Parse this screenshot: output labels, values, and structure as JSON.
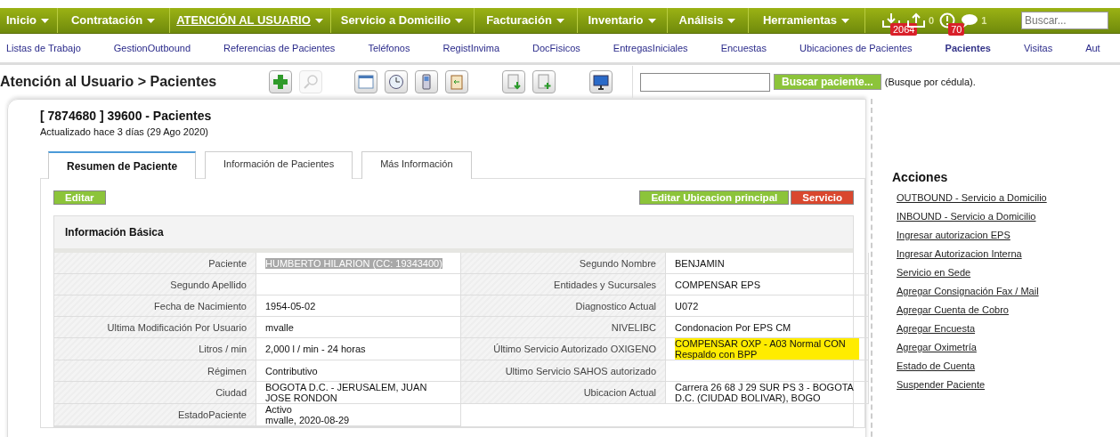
{
  "menu": [
    {
      "label": "Inicio",
      "selected": false
    },
    {
      "label": "Contratación",
      "selected": false
    },
    {
      "label": "ATENCIÓN AL USUARIO",
      "selected": true
    },
    {
      "label": "Servicio a Domicilio",
      "selected": false
    },
    {
      "label": "Facturación",
      "selected": false
    },
    {
      "label": "Inventario",
      "selected": false
    },
    {
      "label": "Análisis",
      "selected": false
    },
    {
      "label": "Herramientas",
      "selected": false
    }
  ],
  "notifications": [
    {
      "kind": "download",
      "badge": "2064"
    },
    {
      "kind": "upload",
      "count": "0"
    },
    {
      "kind": "alert",
      "badge": "70"
    },
    {
      "kind": "chat",
      "count": "1"
    }
  ],
  "search": {
    "placeholder": "Buscar..."
  },
  "submenu": [
    {
      "label": "Listas de Trabajo",
      "selected": false
    },
    {
      "label": "GestionOutbound",
      "selected": false
    },
    {
      "label": "Referencias de Pacientes",
      "selected": false
    },
    {
      "label": "Teléfonos",
      "selected": false
    },
    {
      "label": "RegistInvima",
      "selected": false
    },
    {
      "label": "DocFisicos",
      "selected": false
    },
    {
      "label": "EntregasIniciales",
      "selected": false
    },
    {
      "label": "Encuestas",
      "selected": false
    },
    {
      "label": "Ubicaciones de Pacientes",
      "selected": false
    },
    {
      "label": "Pacientes",
      "selected": true
    },
    {
      "label": "Visitas",
      "selected": false
    },
    {
      "label": "Aut",
      "selected": false
    }
  ],
  "breadcrumb": {
    "parent": "Atención al Usuario",
    "separator": ">",
    "current": "Pacientes"
  },
  "toolbar": [
    {
      "kind": "plus",
      "disabled": false
    },
    {
      "kind": "search",
      "disabled": true
    },
    {
      "kind": "calendar",
      "disabled": false
    },
    {
      "kind": "clock",
      "disabled": false
    },
    {
      "kind": "phone",
      "disabled": false
    },
    {
      "kind": "clipboard",
      "disabled": false
    },
    {
      "kind": "doc-down",
      "disabled": false
    },
    {
      "kind": "doc-plus",
      "disabled": false
    },
    {
      "kind": "monitor",
      "disabled": false
    }
  ],
  "patient_search": {
    "button": "Buscar paciente...",
    "hint": "(Busque por cédula)."
  },
  "record": {
    "title": "[ 7874680 ] 39600 - Pacientes",
    "updated": "Actualizado hace 3 días (29 Ago 2020)"
  },
  "tabs": [
    {
      "label": "Resumen de Paciente",
      "selected": true
    },
    {
      "label": "Información de Pacientes",
      "selected": false
    },
    {
      "label": "Más Información",
      "selected": false
    }
  ],
  "buttons": [
    {
      "label": "Editar",
      "kind": "green"
    },
    {
      "label": "Editar Ubicacion principal",
      "kind": "green"
    },
    {
      "label": "Servicio",
      "kind": "red"
    }
  ],
  "section": {
    "title": "Información Básica"
  },
  "rows": [
    [
      {
        "label": "Paciente",
        "value": "HUMBERTO HILARION (CC: 19343400)",
        "selected": true,
        "highlighted": false
      },
      {
        "label": "Segundo Nombre",
        "value": "BENJAMIN",
        "selected": false,
        "highlighted": false
      }
    ],
    [
      {
        "label": "Segundo Apellido",
        "selected": false,
        "highlighted": false
      },
      {
        "label": "Entidades y Sucursales",
        "value": "COMPENSAR EPS",
        "selected": false,
        "highlighted": false
      }
    ],
    [
      {
        "label": "Fecha de Nacimiento",
        "value": "1954-05-02",
        "selected": false,
        "highlighted": false
      },
      {
        "label": "Diagnostico Actual",
        "value": "U072",
        "selected": false,
        "highlighted": false
      }
    ],
    [
      {
        "label": "Ultima Modificación Por Usuario",
        "value": "mvalle",
        "selected": false,
        "highlighted": false
      },
      {
        "label": "NIVELIBC",
        "value": "Condonacion Por EPS CM",
        "selected": false,
        "highlighted": false
      }
    ],
    [
      {
        "label": "Litros / min",
        "value": "2,000 l / min - 24 horas",
        "selected": false,
        "highlighted": false
      },
      {
        "label": "Último Servicio Autorizado OXIGENO",
        "value": "COMPENSAR OXP - A03 Normal CON Respaldo con BPP",
        "selected": false,
        "highlighted": true
      }
    ],
    [
      {
        "label": "Régimen",
        "value": "Contributivo",
        "selected": false,
        "highlighted": false
      },
      {
        "label": "Ultimo Servicio SAHOS autorizado",
        "selected": false,
        "highlighted": false
      }
    ],
    [
      {
        "label": "Ciudad",
        "value": "BOGOTA D.C. - JERUSALEM, JUAN JOSE RONDON",
        "selected": false,
        "highlighted": false
      },
      {
        "label": "Ubicacion Actual",
        "value": "Carrera 26 68 J 29 SUR PS 3 - BOGOTA D.C. (CIUDAD BOLIVAR), BOGO",
        "selected": false,
        "highlighted": false
      }
    ],
    [
      {
        "label": "EstadoPaciente",
        "value": "Activo\nmvalle, 2020-08-29",
        "selected": false,
        "highlighted": false
      }
    ]
  ],
  "actions": {
    "title": "Acciones",
    "links": [
      "OUTBOUND - Servicio a Domicilio",
      "INBOUND - Servicio a Domicilio",
      "Ingresar autorizacion EPS",
      "Ingresar Autorizacion Interna",
      "Servicio en Sede",
      "Agregar Consignación Fax / Mail",
      "Agregar Cuenta de Cobro",
      "Agregar Encuesta",
      "Agregar Oximetría",
      "Estado de Cuenta",
      "Suspender Paciente"
    ]
  }
}
